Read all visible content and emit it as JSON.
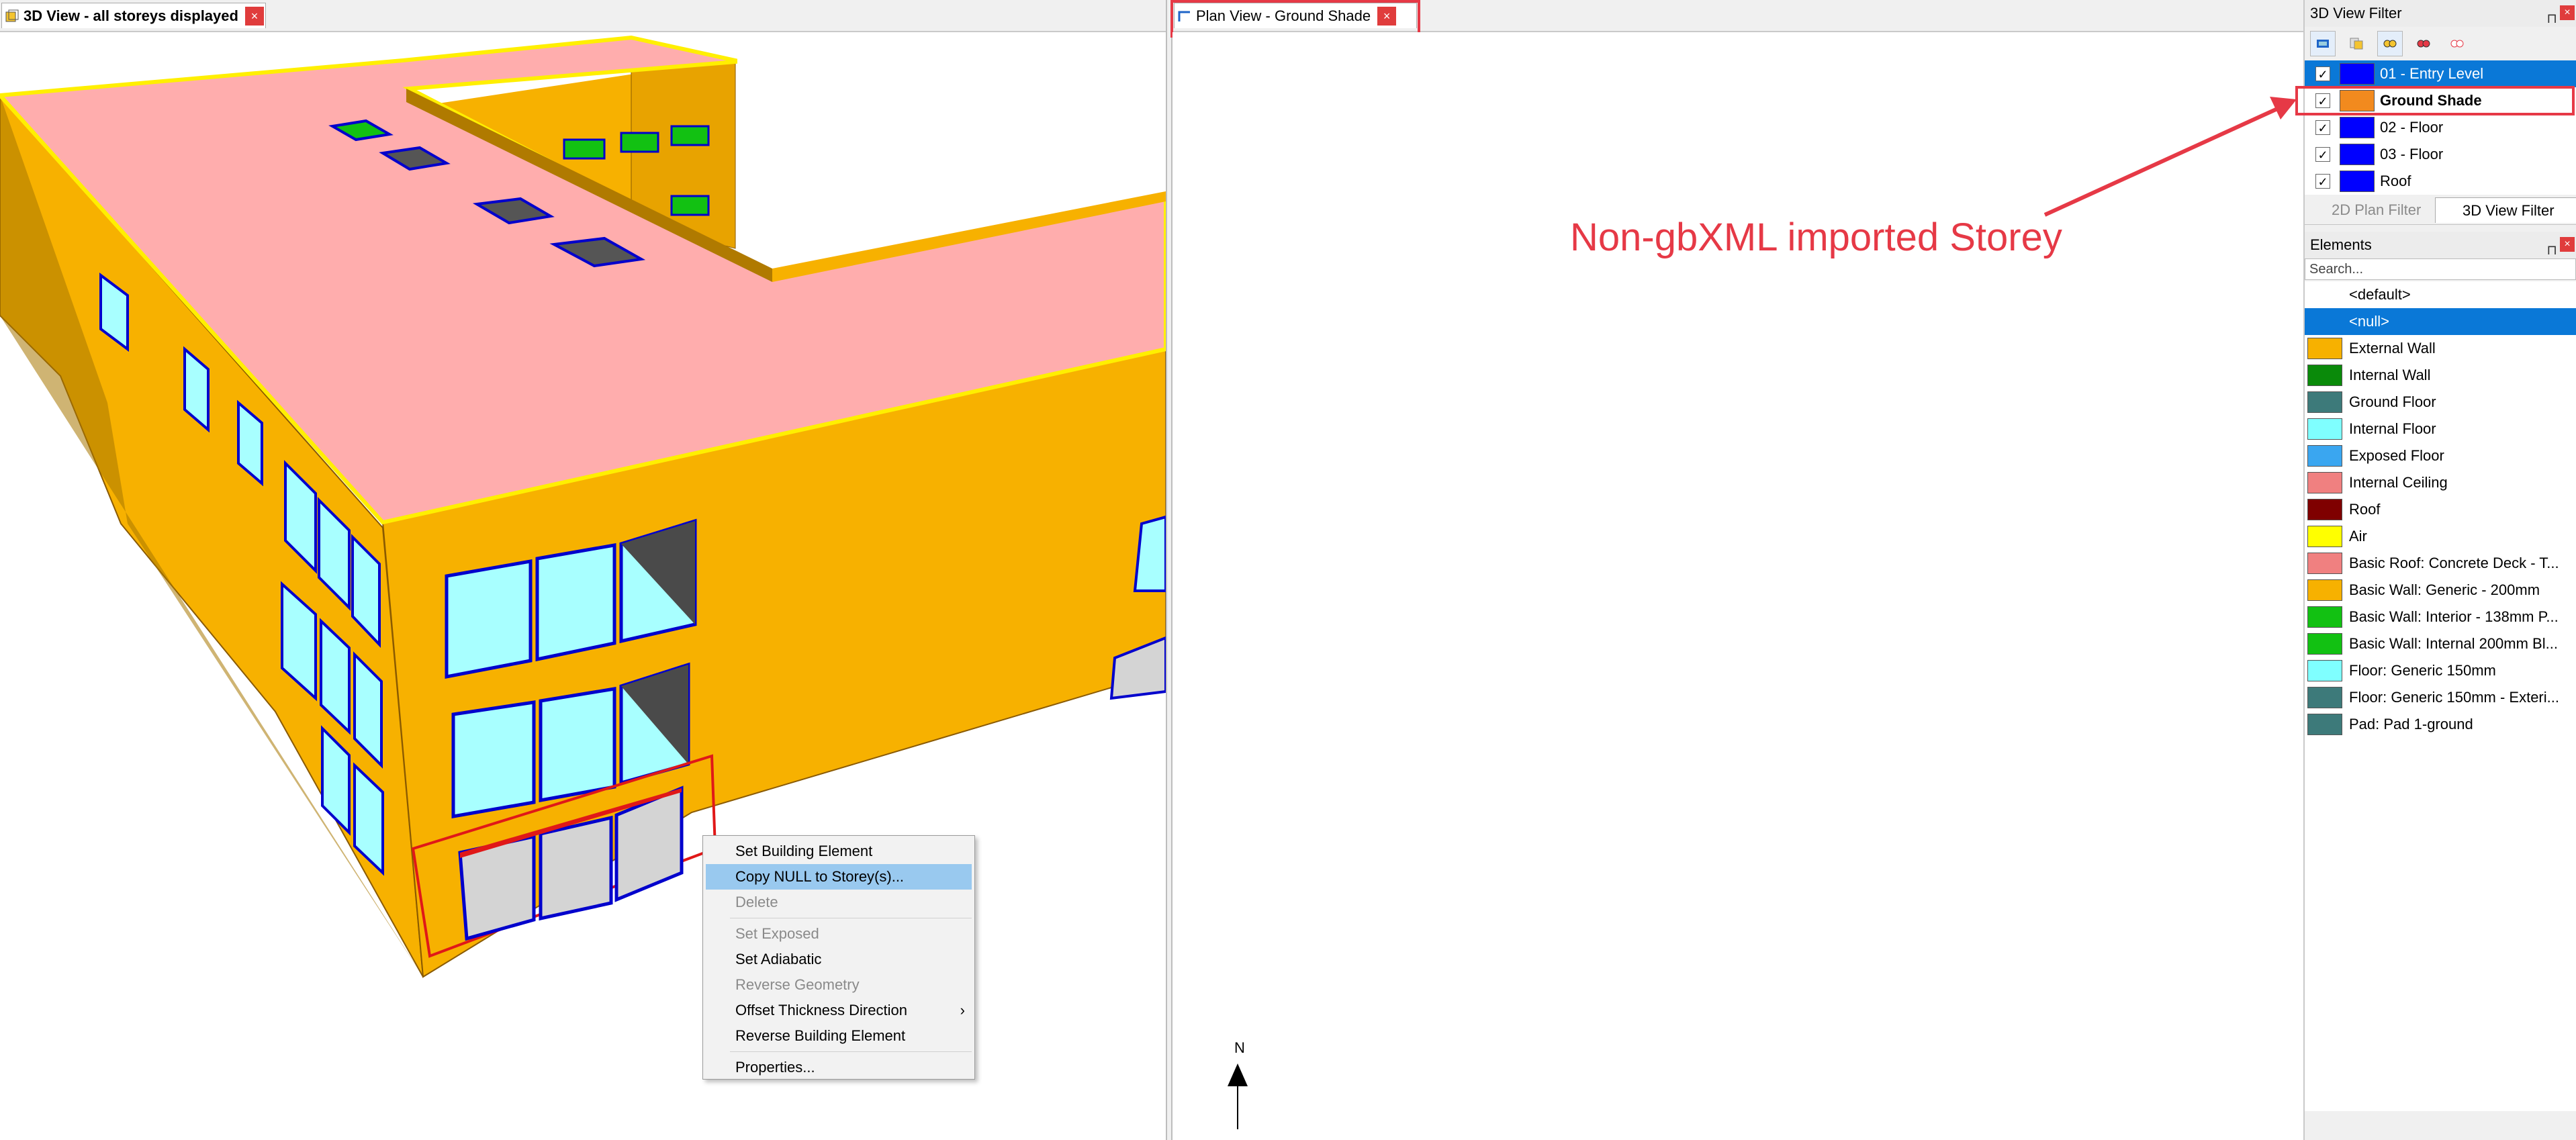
{
  "view3d_tab": {
    "title": "3D View - all storeys displayed",
    "close": "×"
  },
  "plan_tab": {
    "title": "Plan View - Ground Shade",
    "close": "×"
  },
  "context_menu": {
    "items": [
      {
        "label": "Set Building Element",
        "enabled": true,
        "highlighted": false
      },
      {
        "label": "Copy NULL to Storey(s)...",
        "enabled": true,
        "highlighted": true
      },
      {
        "label": "Delete",
        "enabled": false,
        "highlighted": false
      },
      {
        "label": "Set Exposed",
        "enabled": false,
        "highlighted": false
      },
      {
        "label": "Set Adiabatic",
        "enabled": true,
        "highlighted": false
      },
      {
        "label": "Reverse Geometry",
        "enabled": false,
        "highlighted": false
      },
      {
        "label": "Offset Thickness Direction",
        "enabled": true,
        "highlighted": false,
        "submenu": true
      },
      {
        "label": "Reverse Building Element",
        "enabled": true,
        "highlighted": false
      },
      {
        "label": "Properties...",
        "enabled": true,
        "highlighted": false
      }
    ],
    "submenu_arrow": "›"
  },
  "annotation": {
    "text": "Non-gbXML imported Storey",
    "color": "#e63946"
  },
  "north": {
    "label": "N"
  },
  "view_filter": {
    "title": "3D View Filter",
    "pin": "⊓",
    "close": "×",
    "storeys": [
      {
        "name": "01 - Entry Level",
        "color": "#0000ff",
        "checked": true,
        "selected": true
      },
      {
        "name": "Ground Shade",
        "color": "#f28a1e",
        "checked": true,
        "selected": false,
        "bold": true
      },
      {
        "name": "02 - Floor",
        "color": "#0000ff",
        "checked": true,
        "selected": false
      },
      {
        "name": "03 - Floor",
        "color": "#0000ff",
        "checked": true,
        "selected": false
      },
      {
        "name": "Roof",
        "color": "#0000ff",
        "checked": true,
        "selected": false
      }
    ],
    "tabs": [
      {
        "label": "2D Plan Filter",
        "active": false
      },
      {
        "label": "3D View Filter",
        "active": true
      }
    ]
  },
  "elements": {
    "title": "Elements",
    "pin": "⊓",
    "close": "×",
    "search_placeholder": "Search...",
    "items": [
      {
        "name": "<default>",
        "color": null,
        "selected": false
      },
      {
        "name": "<null>",
        "color": null,
        "selected": true
      },
      {
        "name": "External Wall",
        "color": "#f7b100"
      },
      {
        "name": "Internal Wall",
        "color": "#0a8a0a"
      },
      {
        "name": "Ground Floor",
        "color": "#3d7a7a"
      },
      {
        "name": "Internal Floor",
        "color": "#7fffff"
      },
      {
        "name": "Exposed Floor",
        "color": "#3aa6f0"
      },
      {
        "name": "Internal Ceiling",
        "color": "#f08080"
      },
      {
        "name": "Roof",
        "color": "#7f0000"
      },
      {
        "name": "Air",
        "color": "#ffff00"
      },
      {
        "name": "Basic Roof: Concrete Deck - T...",
        "color": "#f08080"
      },
      {
        "name": "Basic Wall: Generic - 200mm",
        "color": "#f7b100"
      },
      {
        "name": "Basic Wall: Interior - 138mm P...",
        "color": "#12c112"
      },
      {
        "name": "Basic Wall: Internal 200mm Bl...",
        "color": "#12c112"
      },
      {
        "name": "Floor: Generic 150mm",
        "color": "#7fffff"
      },
      {
        "name": "Floor: Generic 150mm - Exteri...",
        "color": "#3d7a7a"
      },
      {
        "name": "Pad: Pad 1-ground",
        "color": "#3d7a7a"
      }
    ]
  }
}
